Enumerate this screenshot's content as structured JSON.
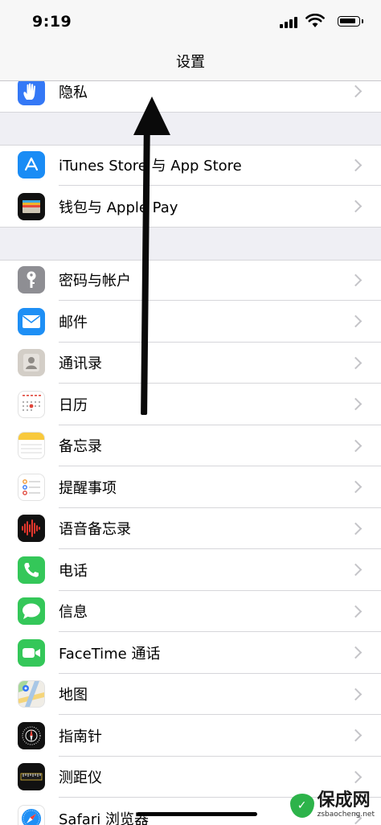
{
  "status": {
    "time": "9:19"
  },
  "nav": {
    "title": "设置"
  },
  "groups": [
    {
      "rows": [
        {
          "label": "隐私",
          "icon": "hand-icon",
          "color": "#3478f6"
        }
      ]
    },
    {
      "rows": [
        {
          "label": "iTunes Store 与 App Store",
          "icon": "app-store-icon",
          "color": "#1a8cf5"
        },
        {
          "label": "钱包与 Apple Pay",
          "icon": "wallet-icon",
          "color": "#111111"
        }
      ]
    },
    {
      "rows": [
        {
          "label": "密码与帐户",
          "icon": "key-icon",
          "color": "#8e8e93"
        },
        {
          "label": "邮件",
          "icon": "mail-icon",
          "color": "#1e8ff5"
        },
        {
          "label": "通讯录",
          "icon": "contacts-icon",
          "color": "#c9c4bd"
        },
        {
          "label": "日历",
          "icon": "calendar-icon",
          "color": "#ffffff"
        },
        {
          "label": "备忘录",
          "icon": "notes-icon",
          "color": "#ffffff"
        },
        {
          "label": "提醒事项",
          "icon": "reminders-icon",
          "color": "#ffffff"
        },
        {
          "label": "语音备忘录",
          "icon": "voice-memos-icon",
          "color": "#111111"
        },
        {
          "label": "电话",
          "icon": "phone-icon",
          "color": "#34c759"
        },
        {
          "label": "信息",
          "icon": "messages-icon",
          "color": "#34c759"
        },
        {
          "label": "FaceTime 通话",
          "icon": "facetime-icon",
          "color": "#34c759"
        },
        {
          "label": "地图",
          "icon": "maps-icon",
          "color": "#e9eef0"
        },
        {
          "label": "指南针",
          "icon": "compass-icon",
          "color": "#111111"
        },
        {
          "label": "测距仪",
          "icon": "measure-icon",
          "color": "#111111"
        },
        {
          "label": "Safari 浏览器",
          "icon": "safari-icon",
          "color": "#ffffff"
        }
      ]
    }
  ],
  "watermark": {
    "brand": "保成网",
    "url": "zsbaocheng.net"
  }
}
